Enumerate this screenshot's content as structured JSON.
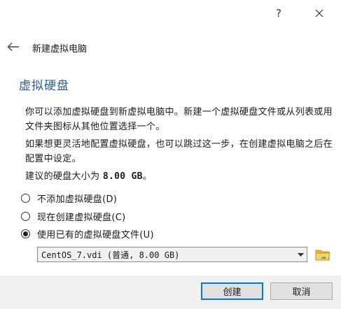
{
  "titlebar": {
    "help_label": "?",
    "close_icon": "close-icon"
  },
  "header": {
    "back_icon": "back-arrow-icon",
    "wizard_title": "新建虚拟电脑"
  },
  "page": {
    "title": "虚拟硬盘",
    "para1": "你可以添加虚拟硬盘到新虚拟电脑中。新建一个虚拟硬盘文件或从列表或用文件夹图标从其他位置选择一个。",
    "para2": "如果想更灵活地配置虚拟硬盘，也可以跳过这一步，在创建虚拟电脑之后在配置中设定。",
    "recommended_prefix": "建议的硬盘大小为 ",
    "recommended_size": "8.00 GB",
    "recommended_suffix": "。"
  },
  "options": [
    {
      "label": "不添加虚拟硬盘(D)",
      "checked": false
    },
    {
      "label": "现在创建虚拟硬盘(C)",
      "checked": false
    },
    {
      "label": "使用已有的虚拟硬盘文件(U)",
      "checked": true
    }
  ],
  "disk_select": {
    "value": "CentOS_7.vdi (普通, 8.00 GB)",
    "folder_icon": "folder-icon"
  },
  "footer": {
    "create_label": "创建",
    "cancel_label": "取消"
  },
  "colors": {
    "title_blue": "#2e5d93",
    "focus_blue": "#0078d7"
  }
}
